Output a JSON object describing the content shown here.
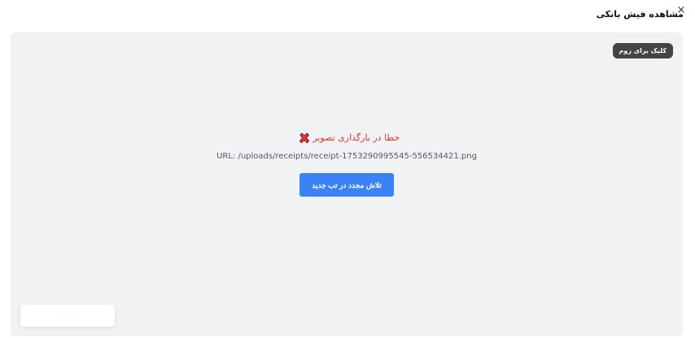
{
  "modal": {
    "title": "مشاهده فیش بانکی",
    "close_icon": "×"
  },
  "viewer": {
    "zoom_badge": "کلیک برای زوم",
    "error_text": "خطا در بارگذاری تصویر",
    "error_icon": "x-mark-icon",
    "url_text": "URL: /uploads/receipts/receipt-1753290995545-556534421.png",
    "retry_label": "تلاش مجدد در تب جدید",
    "toast_text": "··· ··· ···"
  },
  "colors": {
    "accent": "#3b82f6",
    "error": "#d63a3a",
    "viewer_bg": "#f1f2f4",
    "badge_bg": "#444444"
  }
}
